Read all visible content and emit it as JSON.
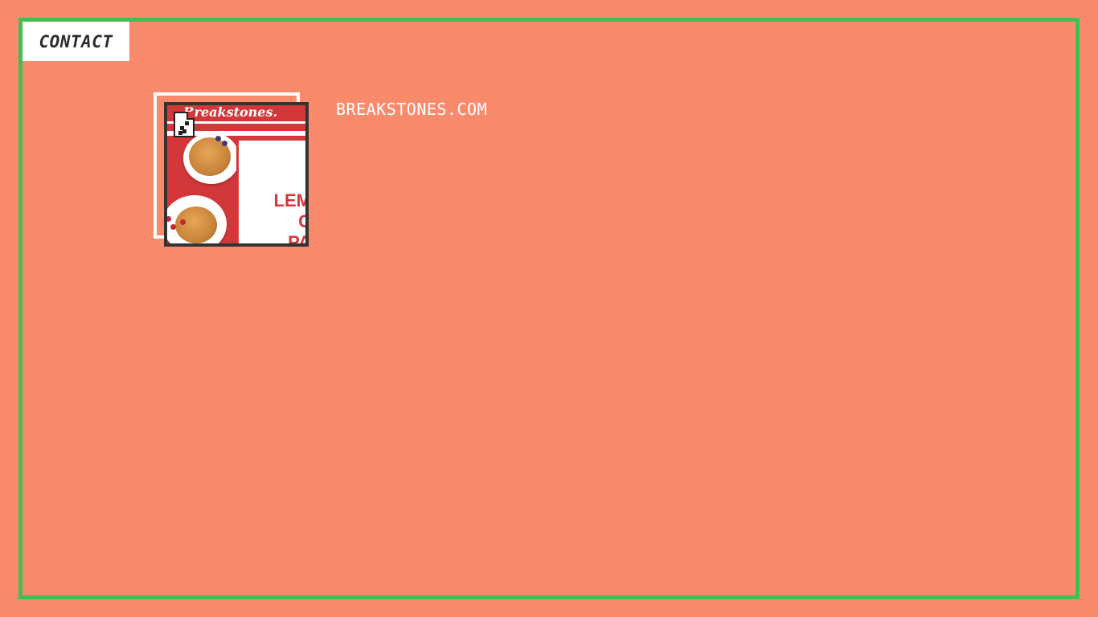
{
  "header": {
    "contact_label": "CONTACT"
  },
  "card": {
    "thumbnail_brand": "Breakstones.",
    "thumbnail_headline": "LEM\n  C\nPA",
    "thumbnail_icon": "broken-image-icon",
    "site_link": "BREAKSTONES.COM"
  },
  "colors": {
    "background": "#f98b6c",
    "frame_border": "#3fbf55",
    "brand_red": "#d2383a",
    "text_light": "#ffffff"
  }
}
